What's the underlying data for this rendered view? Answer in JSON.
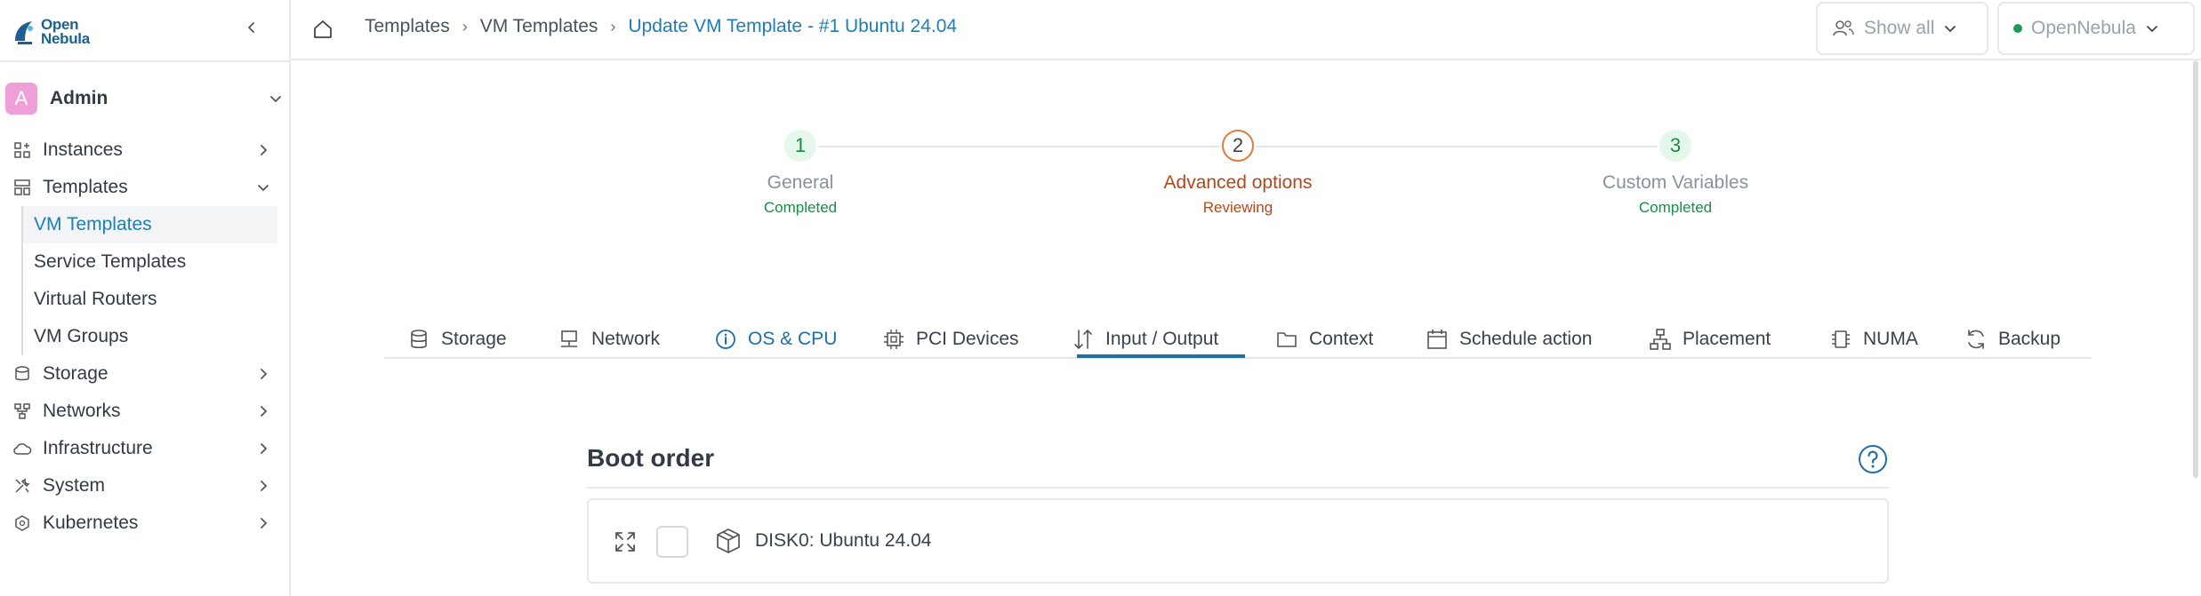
{
  "brand": {
    "line1": "Open",
    "line2": "Nebula"
  },
  "user": {
    "initial": "A",
    "name": "Admin"
  },
  "nav": {
    "instances": "Instances",
    "templates": "Templates",
    "templates_sub": [
      "VM Templates",
      "Service Templates",
      "Virtual Routers",
      "VM Groups"
    ],
    "storage": "Storage",
    "networks": "Networks",
    "infrastructure": "Infrastructure",
    "system": "System",
    "kubernetes": "Kubernetes"
  },
  "breadcrumb": {
    "items": [
      "Templates",
      "VM Templates",
      "Update VM Template - #1 Ubuntu 24.04"
    ]
  },
  "topbar": {
    "group_filter": "Show all",
    "zone": "OpenNebula"
  },
  "stepper": {
    "steps": [
      {
        "number": "1",
        "title": "General",
        "status": "Completed"
      },
      {
        "number": "2",
        "title": "Advanced options",
        "status": "Reviewing"
      },
      {
        "number": "3",
        "title": "Custom Variables",
        "status": "Completed"
      }
    ]
  },
  "tabs": [
    "Storage",
    "Network",
    "OS & CPU",
    "PCI Devices",
    "Input / Output",
    "Context",
    "Schedule action",
    "Placement",
    "NUMA",
    "Backup"
  ],
  "active_tab": "OS & CPU",
  "boot_order": {
    "title": "Boot order",
    "items": [
      {
        "label": "DISK0: Ubuntu 24.04",
        "checked": false
      }
    ]
  },
  "colors": {
    "accent": "#1f7eb5",
    "completed": "#1d8a4a",
    "reviewing": "#b4471a",
    "avatar": "#f0a0d8"
  }
}
